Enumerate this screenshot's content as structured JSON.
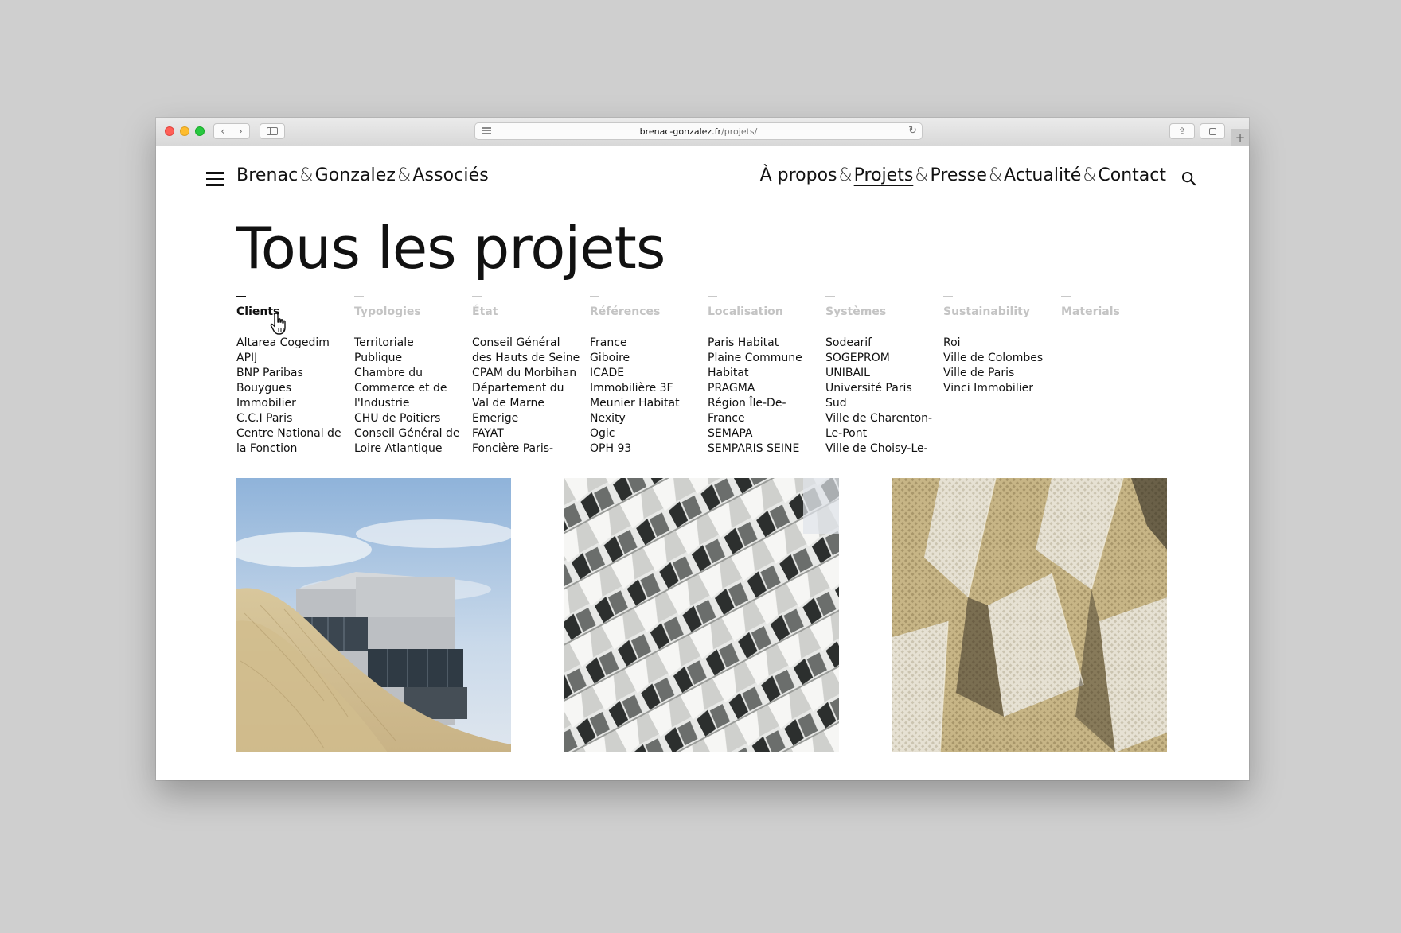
{
  "browser": {
    "url_domain": "brenac-gonzalez.fr",
    "url_path": "/projets/",
    "back_glyph": "‹",
    "forward_glyph": "›",
    "reload_glyph": "↻",
    "share_glyph": "⇪",
    "new_tab_glyph": "+"
  },
  "site": {
    "brand_part1": "Brenac",
    "brand_part2": "Gonzalez",
    "brand_part3": "Associés",
    "amp": "&",
    "nav": {
      "about": "À propos",
      "projects": "Projets",
      "press": "Presse",
      "news": "Actualité",
      "contact": "Contact"
    }
  },
  "page": {
    "title": "Tous les projets"
  },
  "filters": [
    {
      "title": "Clients",
      "active": true,
      "items": [
        "Altarea Cogedim",
        "APIJ",
        "BNP Paribas",
        "Bouygues",
        "Immobilier",
        "C.C.I Paris",
        "Centre National de",
        "la Fonction"
      ]
    },
    {
      "title": "Typologies",
      "active": false,
      "items": [
        "Territoriale",
        "Publique",
        "Chambre du",
        "Commerce et de",
        "l'Industrie",
        "CHU de Poitiers",
        "Conseil Général de",
        "Loire Atlantique"
      ]
    },
    {
      "title": "État",
      "active": false,
      "items": [
        "Conseil Général",
        "des Hauts de Seine",
        "CPAM du Morbihan",
        "Département du",
        "Val de Marne",
        "Emerige",
        "FAYAT",
        "Foncière Paris-"
      ]
    },
    {
      "title": "Références",
      "active": false,
      "items": [
        "France",
        "Giboire",
        "ICADE",
        "Immobilière 3F",
        "Meunier Habitat",
        "Nexity",
        "Ogic",
        "OPH 93"
      ]
    },
    {
      "title": "Localisation",
      "active": false,
      "items": [
        "Paris Habitat",
        "Plaine Commune",
        "Habitat",
        "PRAGMA",
        "Région Île-De-",
        "France",
        "SEMAPA",
        "SEMPARIS SEINE"
      ]
    },
    {
      "title": "Systèmes",
      "active": false,
      "items": [
        "Sodearif",
        "SOGEPROM",
        "UNIBAIL",
        "Université Paris",
        "Sud",
        "Ville de Charenton-",
        "Le-Pont",
        "Ville de Choisy-Le-"
      ]
    },
    {
      "title": "Sustainability",
      "active": false,
      "items": [
        "Roi",
        "Ville de Colombes",
        "Ville de Paris",
        "Vinci Immobilier"
      ]
    },
    {
      "title": "Materials",
      "active": false,
      "items": []
    }
  ],
  "colors": {
    "background": "#cfcfcf",
    "text": "#111111",
    "inactive_filter": "#c4c4c4"
  }
}
